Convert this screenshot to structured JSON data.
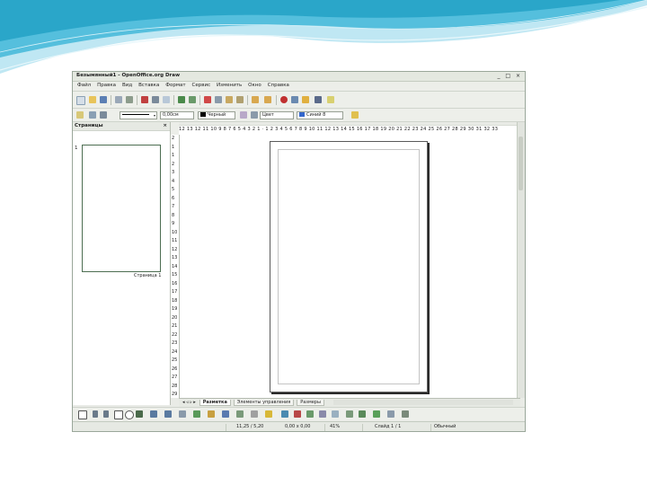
{
  "window": {
    "title": "Безымянный1 - OpenOffice.org Draw",
    "controls": "_ □ ×"
  },
  "menu": [
    "Файл",
    "Правка",
    "Вид",
    "Вставка",
    "Формат",
    "Сервис",
    "Изменить",
    "Окно",
    "Справка"
  ],
  "line_toolbar": {
    "line_width": "0,00см",
    "line_color": "Черный",
    "area_type": "Цвет",
    "area_color": "Синий 8"
  },
  "pages_pane": {
    "title": "Страницы",
    "close": "×",
    "page_number": "1",
    "page_label": "Страница 1"
  },
  "ruler": {
    "horizontal": "12 13 12 11 10 9 8 7 6 5 4 3 2 1 · 1 2 3 4 5 6 7 8 9 10 11 12 13 14 15 16 17 18 19 20 21 22 23 24 25 26 27 28 29 30 31 32 33",
    "vertical": [
      "2",
      "1",
      "1",
      "2",
      "3",
      "4",
      "5",
      "6",
      "7",
      "8",
      "9",
      "10",
      "11",
      "12",
      "13",
      "14",
      "15",
      "16",
      "17",
      "18",
      "19",
      "20",
      "21",
      "22",
      "23",
      "24",
      "25",
      "26",
      "27",
      "28",
      "29"
    ]
  },
  "tabs": {
    "nav": "◂ ◃ ▹ ▸",
    "items": [
      "Разметка",
      "Элементы управления",
      "Размеры"
    ]
  },
  "status": {
    "position": "11,25 / 5,20",
    "size": "0,00 x 0,00",
    "zoom": "41%",
    "slide": "Слайд 1 / 1",
    "layout": "Обычный"
  },
  "colors": {
    "wave_dark": "#2aa6c9",
    "wave_light": "#a9dfee",
    "line_color_swatch": "#000000",
    "area_color_swatch": "#3366cc"
  }
}
